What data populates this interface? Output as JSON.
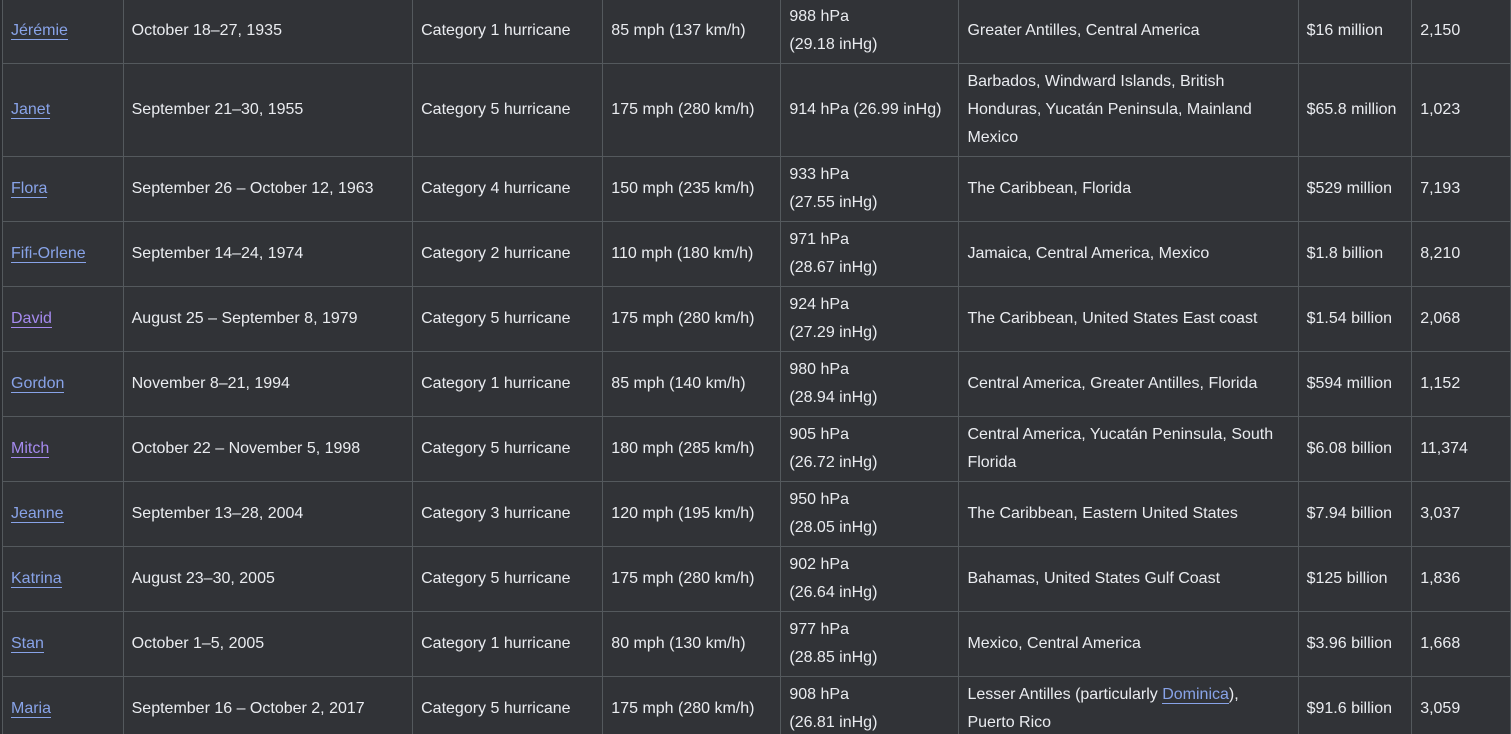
{
  "table": {
    "rows": [
      {
        "name": "Jérémie",
        "visited": false,
        "dates": "October 18–27, 1935",
        "category": "Category 1 hurricane",
        "wind": "85 mph (137 km/h)",
        "pressure": "988 hPa\n(29.18 inHg)",
        "areas": "Greater Antilles, Central America",
        "damage": "$16 million",
        "deaths": "2,150"
      },
      {
        "name": "Janet",
        "visited": false,
        "dates": "September 21–30, 1955",
        "category": "Category 5 hurricane",
        "wind": "175 mph (280 km/h)",
        "pressure": "914 hPa (26.99 inHg)",
        "areas": "Barbados, Windward Islands, British Honduras, Yucatán Peninsula, Mainland Mexico",
        "damage": "$65.8 million",
        "deaths": "1,023",
        "tall": true
      },
      {
        "name": "Flora",
        "visited": false,
        "dates": "September 26 – October 12, 1963",
        "category": "Category 4 hurricane",
        "wind": "150 mph (235 km/h)",
        "pressure": "933 hPa\n(27.55 inHg)",
        "areas": "The Caribbean, Florida",
        "damage": "$529 million",
        "deaths": "7,193"
      },
      {
        "name": "Fifi-Orlene",
        "visited": false,
        "dates": "September 14–24, 1974",
        "category": "Category 2 hurricane",
        "wind": "110 mph (180 km/h)",
        "pressure": "971 hPa\n(28.67 inHg)",
        "areas": "Jamaica, Central America, Mexico",
        "damage": "$1.8 billion",
        "deaths": "8,210"
      },
      {
        "name": "David",
        "visited": true,
        "dates": "August 25 – September 8, 1979",
        "category": "Category 5 hurricane",
        "wind": "175 mph (280 km/h)",
        "pressure": "924 hPa\n(27.29 inHg)",
        "areas": "The Caribbean, United States East coast",
        "damage": "$1.54 billion",
        "deaths": "2,068"
      },
      {
        "name": "Gordon",
        "visited": false,
        "dates": "November 8–21, 1994",
        "category": "Category 1 hurricane",
        "wind": "85 mph (140 km/h)",
        "pressure": "980 hPa\n(28.94 inHg)",
        "areas": "Central America, Greater Antilles, Florida",
        "damage": "$594 million",
        "deaths": "1,152"
      },
      {
        "name": "Mitch",
        "visited": true,
        "dates": "October 22 – November 5, 1998",
        "category": "Category 5 hurricane",
        "wind": "180 mph (285 km/h)",
        "pressure": "905 hPa\n(26.72 inHg)",
        "areas": "Central America, Yucatán Peninsula, South Florida",
        "damage": "$6.08 billion",
        "deaths": "11,374"
      },
      {
        "name": "Jeanne",
        "visited": false,
        "dates": "September 13–28, 2004",
        "category": "Category 3 hurricane",
        "wind": "120 mph (195 km/h)",
        "pressure": "950 hPa\n(28.05 inHg)",
        "areas": "The Caribbean, Eastern United States",
        "damage": "$7.94 billion",
        "deaths": "3,037"
      },
      {
        "name": "Katrina",
        "visited": false,
        "dates": "August 23–30, 2005",
        "category": "Category 5 hurricane",
        "wind": "175 mph (280 km/h)",
        "pressure": "902 hPa\n(26.64 inHg)",
        "areas": "Bahamas, United States Gulf Coast",
        "damage": "$125 billion",
        "deaths": "1,836"
      },
      {
        "name": "Stan",
        "visited": false,
        "dates": "October 1–5, 2005",
        "category": "Category 1 hurricane",
        "wind": "80 mph (130 km/h)",
        "pressure": "977 hPa\n(28.85 inHg)",
        "areas": "Mexico, Central America",
        "damage": "$3.96 billion",
        "deaths": "1,668"
      },
      {
        "name": "Maria",
        "visited": false,
        "dates": "September 16 – October 2, 2017",
        "category": "Category 5 hurricane",
        "wind": "175 mph (280 km/h)",
        "pressure": "908 hPa\n(26.81 inHg)",
        "areas_prefix": "Lesser Antilles (particularly ",
        "areas_link": "Dominica",
        "areas_suffix": "), Puerto Rico",
        "damage": "$91.6 billion",
        "deaths": "3,059"
      }
    ]
  }
}
